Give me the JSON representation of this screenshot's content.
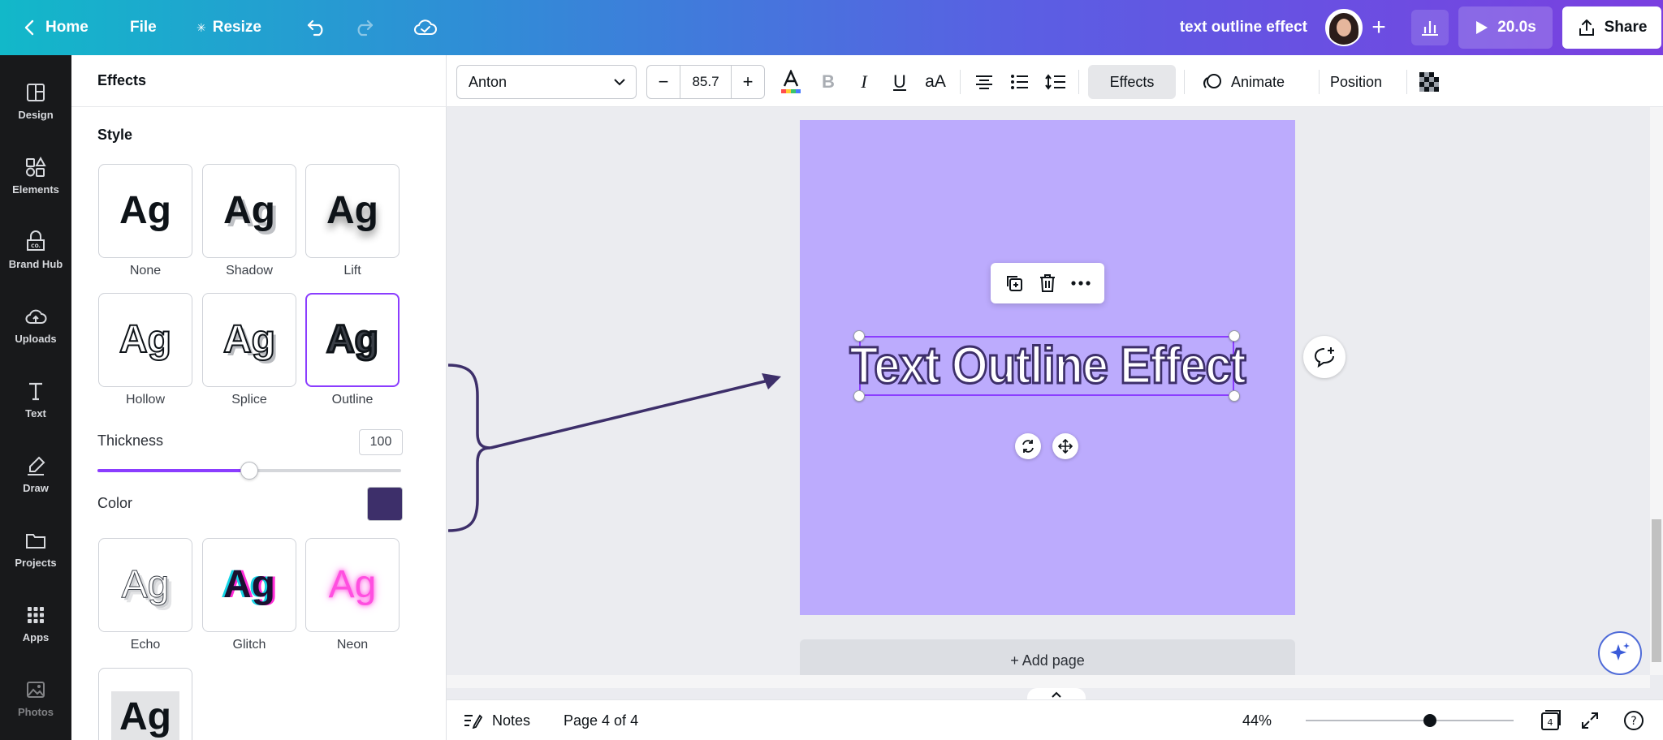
{
  "topbar": {
    "home_label": "Home",
    "file_label": "File",
    "resize_label": "Resize",
    "doc_title": "text outline effect",
    "play_duration": "20.0s",
    "share_label": "Share"
  },
  "rail": {
    "items": [
      {
        "label": "Design",
        "icon": "layout-icon"
      },
      {
        "label": "Elements",
        "icon": "shapes-icon"
      },
      {
        "label": "Brand Hub",
        "icon": "brand-icon"
      },
      {
        "label": "Uploads",
        "icon": "cloud-upload-icon"
      },
      {
        "label": "Text",
        "icon": "text-icon"
      },
      {
        "label": "Draw",
        "icon": "pen-icon"
      },
      {
        "label": "Projects",
        "icon": "folder-icon"
      },
      {
        "label": "Apps",
        "icon": "grid-icon"
      },
      {
        "label": "Photos",
        "icon": "image-icon"
      }
    ]
  },
  "panel": {
    "title": "Effects",
    "style_heading": "Style",
    "sample_text": "Ag",
    "styles": [
      {
        "name": "None",
        "selected": false
      },
      {
        "name": "Shadow",
        "selected": false
      },
      {
        "name": "Lift",
        "selected": false
      },
      {
        "name": "Hollow",
        "selected": false
      },
      {
        "name": "Splice",
        "selected": false
      },
      {
        "name": "Outline",
        "selected": true
      },
      {
        "name": "Echo",
        "selected": false
      },
      {
        "name": "Glitch",
        "selected": false
      },
      {
        "name": "Neon",
        "selected": false
      }
    ],
    "thickness_label": "Thickness",
    "thickness_value": "100",
    "thickness_fraction": 0.5,
    "color_label": "Color",
    "outline_color": "#3d2f6a",
    "accent_color": "#8b3dff"
  },
  "format_toolbar": {
    "font_name": "Anton",
    "font_size": "85.7",
    "minus_label": "−",
    "plus_label": "+",
    "case_label": "aA",
    "effects_label": "Effects",
    "animate_label": "Animate",
    "position_label": "Position"
  },
  "canvas": {
    "headline": "Text Outline Effect",
    "page_color": "#bcabfd",
    "add_page_label": "+ Add page"
  },
  "bottombar": {
    "notes_label": "Notes",
    "page_indicator": "Page 4 of 4",
    "zoom_level": "44%",
    "page_count_badge": "4",
    "help_label": "?"
  }
}
